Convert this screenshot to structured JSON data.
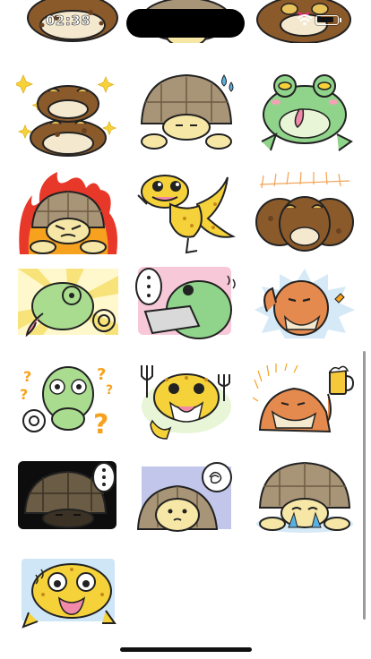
{
  "status_bar": {
    "time": "02:38",
    "icons": [
      "wifi-icon",
      "battery-icon"
    ]
  },
  "stickers": [
    {
      "id": 1,
      "name": "toad-pair-clock"
    },
    {
      "id": 2,
      "name": "tortoise-peek-hidden"
    },
    {
      "id": 3,
      "name": "toad-surprised"
    },
    {
      "id": 4,
      "name": "toad-pair-stacked-sparkles"
    },
    {
      "id": 5,
      "name": "tortoise-resting-sweat"
    },
    {
      "id": 6,
      "name": "frog-tongue-out"
    },
    {
      "id": 7,
      "name": "tortoise-angry-flames"
    },
    {
      "id": 8,
      "name": "leopard-gecko-waving"
    },
    {
      "id": 9,
      "name": "toad-group-three"
    },
    {
      "id": 10,
      "name": "chameleon-tongue-rays"
    },
    {
      "id": 11,
      "name": "frog-speech-bubble-dots"
    },
    {
      "id": 12,
      "name": "bearded-dragon-thumbs-up"
    },
    {
      "id": 13,
      "name": "chameleon-question-marks"
    },
    {
      "id": 14,
      "name": "leopard-gecko-fork-knife"
    },
    {
      "id": 15,
      "name": "bearded-dragon-beer-mug"
    },
    {
      "id": 16,
      "name": "tortoise-dark-bubble-dots"
    },
    {
      "id": 17,
      "name": "tortoise-tangle-bubble"
    },
    {
      "id": 18,
      "name": "tortoise-crying"
    },
    {
      "id": 19,
      "name": "leopard-gecko-shocked"
    }
  ],
  "colors": {
    "toad_brown": "#8b5a2b",
    "toad_belly": "#f4e8cf",
    "tortoise_shell": "#a89476",
    "tortoise_skin": "#f6e7a6",
    "frog_green": "#8fd48a",
    "gecko_yellow": "#f5d23a",
    "chameleon_green": "#a9dc8e",
    "dragon_orange": "#e58a4e",
    "tongue_pink": "#f08aa8",
    "flame_red": "#e8382a",
    "flame_orange": "#f6a21e",
    "ray_yellow": "#f7e37a",
    "outline": "#222222"
  }
}
